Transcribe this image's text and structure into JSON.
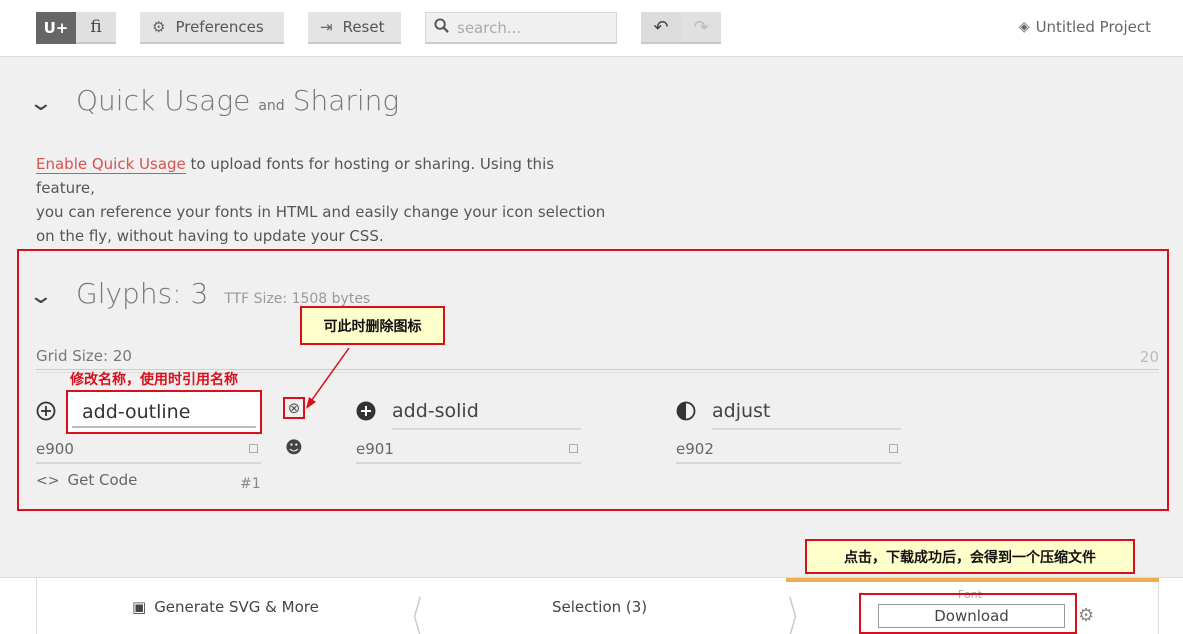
{
  "toolbar": {
    "unicode_toggle": "U+",
    "ligature_toggle": "ﬁ",
    "preferences_label": "Preferences",
    "reset_label": "Reset",
    "search_placeholder": "search...",
    "project_name": "Untitled Project"
  },
  "quick_usage": {
    "title_a": "Quick Usage",
    "title_and": "and",
    "title_b": "Sharing",
    "link_text": "Enable Quick Usage",
    "text_line1": " to upload fonts for hosting or sharing. Using this feature,",
    "text_line2": "you can reference your fonts in HTML and easily change your icon selection",
    "text_line3": "on the fly, without having to update your CSS."
  },
  "glyphs_section": {
    "title": "Glyphs: 3",
    "ttf_size": "TTF Size: 1508 bytes",
    "grid_label": "Grid Size: 20",
    "grid_value": "20",
    "get_code_label": "Get Code",
    "index_label": "#1",
    "items": [
      {
        "name": "add-outline",
        "code": "e900",
        "icon": "add-outline-icon"
      },
      {
        "name": "add-solid",
        "code": "e901",
        "icon": "add-solid-icon"
      },
      {
        "name": "adjust",
        "code": "e902",
        "icon": "adjust-icon"
      }
    ]
  },
  "annotations": {
    "delete_hint": "可此时删除图标",
    "rename_hint": "修改名称，使用时引用名称",
    "download_hint": "点击，下载成功后，会得到一个压缩文件"
  },
  "bottombar": {
    "generate_label": "Generate SVG & More",
    "selection_label": "Selection (3)",
    "font_label": "Font",
    "download_label": "Download"
  },
  "colors": {
    "annotation_red": "#d8101c",
    "callout_bg": "#ffffcc",
    "font_tab_accent": "#f0ad4e"
  }
}
